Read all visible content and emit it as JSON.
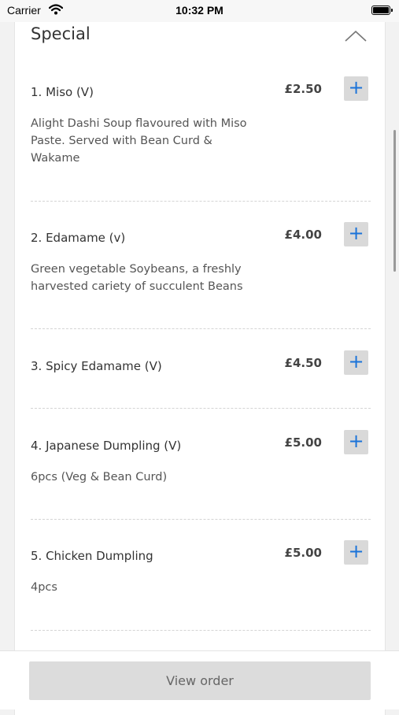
{
  "status_bar": {
    "carrier": "Carrier",
    "time": "10:32 PM"
  },
  "section": {
    "title": "Special"
  },
  "items": [
    {
      "name": "1. Miso (V)",
      "price": "£2.50",
      "add": "+",
      "description_lines": [
        "Alight Dashi Soup flavoured with Miso",
        "Paste. Served with Bean Curd &",
        "Wakame"
      ]
    },
    {
      "name": "2. Edamame (v)",
      "price": "£4.00",
      "add": "+",
      "description_lines": [
        "Green vegetable Soybeans, a freshly",
        "harvested cariety of succulent Beans"
      ]
    },
    {
      "name": "3. Spicy Edamame (V)",
      "price": "£4.50",
      "add": "+",
      "description_lines": []
    },
    {
      "name": "4. Japanese Dumpling (V)",
      "price": "£5.00",
      "add": "+",
      "description_lines": [
        "6pcs (Veg & Bean Curd)"
      ]
    },
    {
      "name": "5. Chicken Dumpling",
      "price": "£5.00",
      "add": "+",
      "description_lines": [
        "4pcs"
      ]
    }
  ],
  "footer": {
    "view_order_label": "View order"
  },
  "colors": {
    "accent": "#1a73d9",
    "button_bg": "#d9d9d9",
    "divider": "#d4d4d4"
  },
  "icons": {
    "collapse": "chevron-up-icon",
    "wifi": "wifi-icon",
    "battery": "battery-icon",
    "add": "plus-icon"
  }
}
